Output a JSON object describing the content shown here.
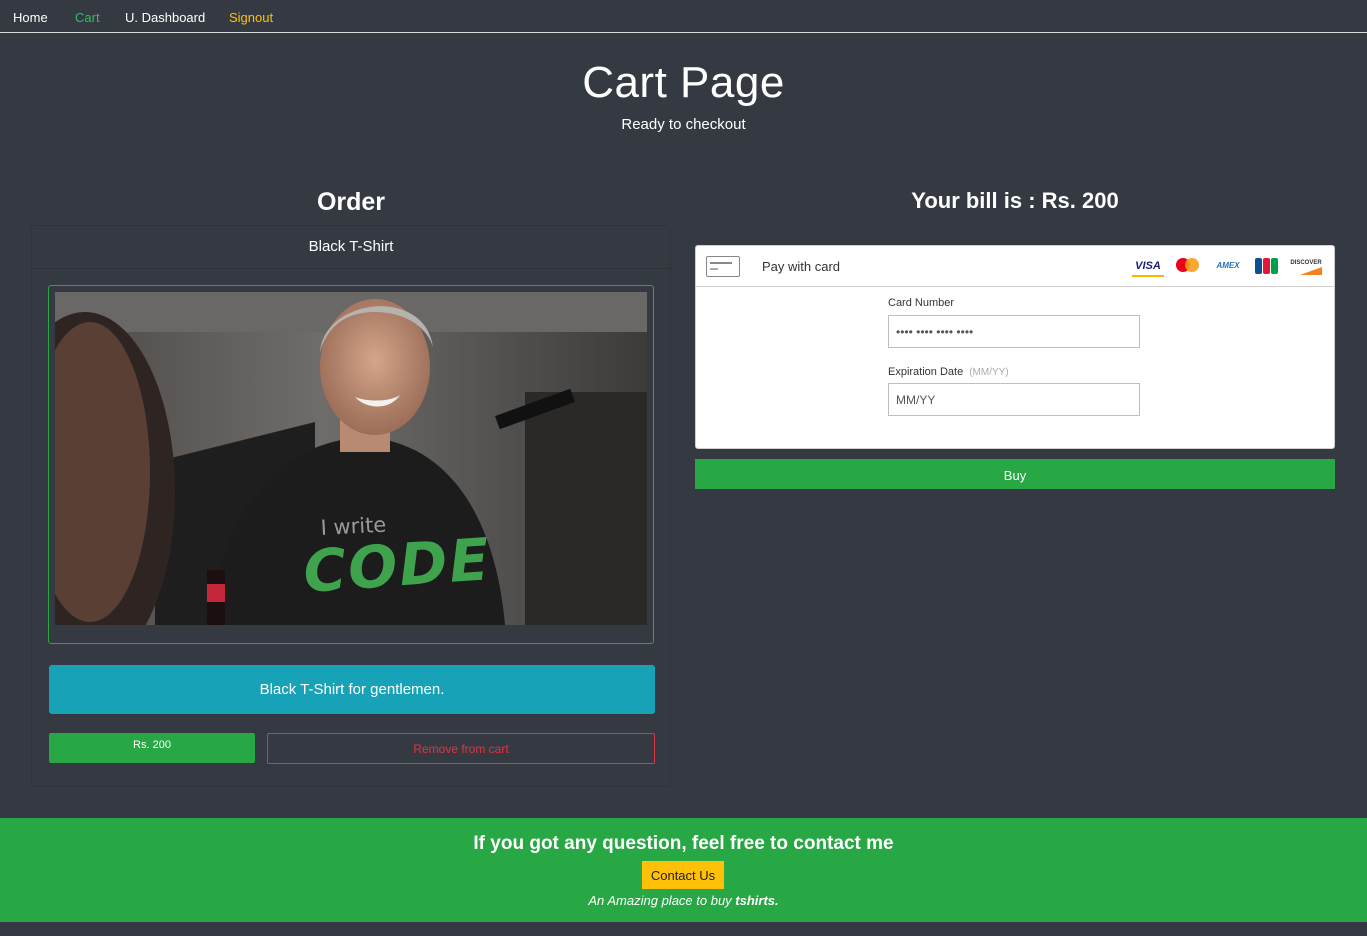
{
  "nav": {
    "home": "Home",
    "cart": "Cart",
    "dashboard": "U. Dashboard",
    "signout": "Signout"
  },
  "hero": {
    "title": "Cart Page",
    "subtitle": "Ready to checkout"
  },
  "order": {
    "heading": "Order",
    "product_name": "Black T-Shirt",
    "shirt_text_line1": "I write",
    "shirt_text_line2": "CODE",
    "description": "Black T-Shirt for gentlemen.",
    "price": "Rs. 200",
    "remove_label": "Remove from cart"
  },
  "bill": {
    "heading": "Your bill is : Rs. 200",
    "pay_title": "Pay with card",
    "card_brands": [
      "VISA",
      "mastercard",
      "AMEX",
      "JCB",
      "DISCOVER"
    ],
    "card_number_label": "Card Number",
    "card_number_placeholder": "•••• •••• •••• ••••",
    "expiry_label": "Expiration Date",
    "expiry_hint": "(MM/YY)",
    "expiry_placeholder": "MM/YY",
    "buy_label": "Buy"
  },
  "footer": {
    "question": "If you got any question, feel free to contact me",
    "contact_label": "Contact Us",
    "tagline_prefix": "An Amazing place to buy ",
    "tagline_brand": "tshirts."
  },
  "colors": {
    "background": "#353a42",
    "success": "#28a745",
    "info": "#17a2b8",
    "warning": "#ffc107",
    "danger": "#dc3545"
  }
}
